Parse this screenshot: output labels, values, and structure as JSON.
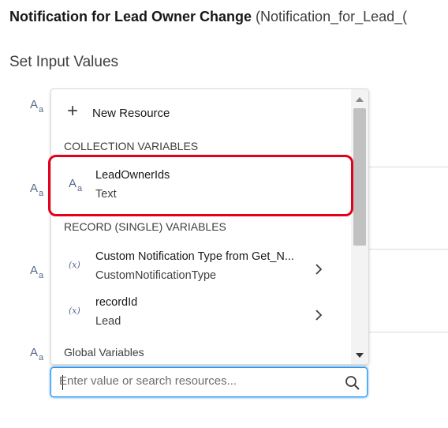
{
  "header": {
    "title": "Notification for Lead Owner Change",
    "api_name": "(Notification_for_Lead_("
  },
  "section": {
    "label": "Set Input Values"
  },
  "row_icons": [
    {
      "main": "A",
      "sub": "a"
    },
    {
      "main": "A",
      "sub": "a"
    },
    {
      "main": "A",
      "sub": "a"
    },
    {
      "main": "A",
      "sub": "a"
    }
  ],
  "dropdown": {
    "new_resource_label": "New Resource",
    "groups": {
      "collection": "COLLECTION VARIABLES",
      "record": "RECORD (SINGLE) VARIABLES",
      "global": "Global Variables"
    },
    "items": [
      {
        "label": "LeadOwnerIds",
        "sublabel": "Text",
        "icon": "text-icon",
        "icon_main": "A",
        "icon_sub": "a"
      },
      {
        "label": "Custom Notification Type from Get_N...",
        "sublabel": "CustomNotificationType",
        "icon": "variable-icon",
        "icon_glyph": "(x)"
      },
      {
        "label": "recordId",
        "sublabel": "Lead",
        "icon": "variable-icon",
        "icon_glyph": "(x)"
      }
    ],
    "highlight_color": "#e3001b"
  },
  "search": {
    "placeholder": "Enter value or search resources...",
    "value": ""
  }
}
